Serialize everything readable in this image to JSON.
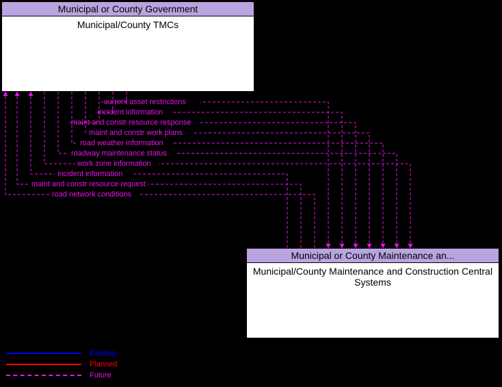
{
  "boxes": {
    "top": {
      "header": "Municipal or County Government",
      "body": "Municipal/County TMCs"
    },
    "bottom": {
      "header": "Municipal or County Maintenance an...",
      "body": "Municipal/County Maintenance and Construction Central Systems"
    }
  },
  "flows": {
    "f1": "current asset restrictions",
    "f2": "incident information",
    "f3": "maint and constr resource response",
    "f4": "maint and constr work plans",
    "f5": "road weather information",
    "f6": "roadway maintenance status",
    "f7": "work zone information",
    "f8": "incident information",
    "f9": "maint and constr resource request",
    "f10": "road network conditions"
  },
  "legend": {
    "existing": "Existing",
    "planned": "Planned",
    "future": "Future"
  },
  "chart_data": {
    "type": "diagram",
    "nodes": [
      {
        "id": "tmc",
        "stakeholder": "Municipal or County Government",
        "element": "Municipal/County TMCs"
      },
      {
        "id": "mcms",
        "stakeholder": "Municipal or County Maintenance and Construction",
        "element": "Municipal/County Maintenance and Construction Central Systems"
      }
    ],
    "edges": [
      {
        "from": "mcms",
        "to": "tmc",
        "label": "current asset restrictions",
        "status": "Future"
      },
      {
        "from": "mcms",
        "to": "tmc",
        "label": "incident information",
        "status": "Future"
      },
      {
        "from": "mcms",
        "to": "tmc",
        "label": "maint and constr resource response",
        "status": "Future"
      },
      {
        "from": "mcms",
        "to": "tmc",
        "label": "maint and constr work plans",
        "status": "Future"
      },
      {
        "from": "mcms",
        "to": "tmc",
        "label": "road weather information",
        "status": "Future"
      },
      {
        "from": "mcms",
        "to": "tmc",
        "label": "roadway maintenance status",
        "status": "Future"
      },
      {
        "from": "mcms",
        "to": "tmc",
        "label": "work zone information",
        "status": "Future"
      },
      {
        "from": "tmc",
        "to": "mcms",
        "label": "incident information",
        "status": "Future"
      },
      {
        "from": "tmc",
        "to": "mcms",
        "label": "maint and constr resource request",
        "status": "Future"
      },
      {
        "from": "tmc",
        "to": "mcms",
        "label": "road network conditions",
        "status": "Future"
      }
    ],
    "legend": [
      {
        "label": "Existing",
        "style": "solid",
        "color": "#0000ff"
      },
      {
        "label": "Planned",
        "style": "solid",
        "color": "#ff0000"
      },
      {
        "label": "Future",
        "style": "dashed",
        "color": "#e815e8"
      }
    ]
  }
}
